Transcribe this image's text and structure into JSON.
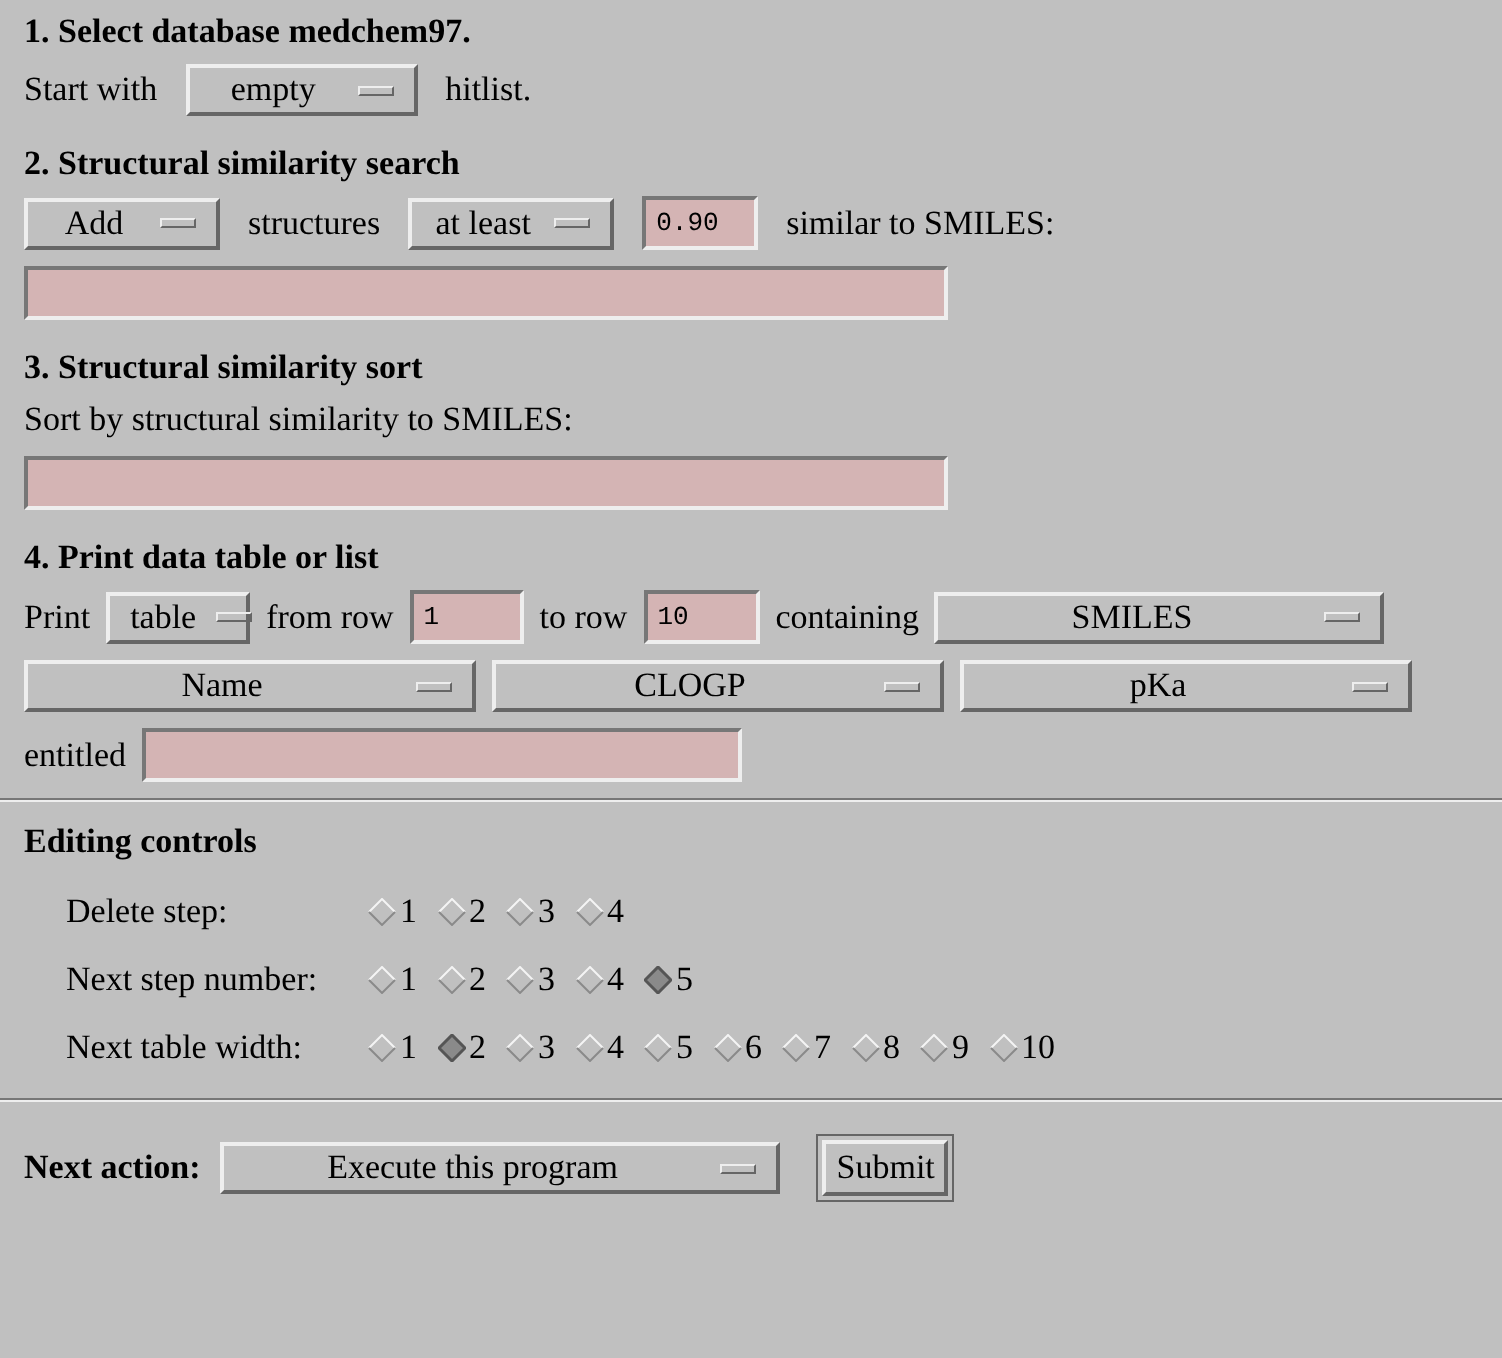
{
  "sections": [
    {
      "title": "1. Select database medchem97.",
      "rows": [
        {
          "items": [
            {
              "kind": "text",
              "text": "Start with"
            },
            {
              "kind": "menu",
              "value": "empty"
            },
            {
              "kind": "text",
              "text": "hitlist."
            }
          ]
        }
      ]
    },
    {
      "title": "2. Structural similarity search",
      "rows": [
        {
          "items": [
            {
              "kind": "menu",
              "value": "Add"
            },
            {
              "kind": "text",
              "text": "structures"
            },
            {
              "kind": "menu",
              "value": "at least"
            },
            {
              "kind": "input",
              "value": "0.90"
            },
            {
              "kind": "text",
              "text": "similar to SMILES:"
            }
          ]
        },
        {
          "items": [
            {
              "kind": "input"
            }
          ]
        }
      ]
    },
    {
      "title": "3. Structural similarity sort",
      "rows": [
        {
          "items": [
            {
              "kind": "text",
              "text": "Sort by structural similarity to SMILES:"
            }
          ]
        },
        {
          "items": [
            {
              "kind": "input"
            }
          ]
        }
      ]
    },
    {
      "title": "4. Print data table or list",
      "rows": [
        {
          "items": [
            {
              "kind": "text",
              "text": "Print"
            },
            {
              "kind": "menu",
              "value": "table"
            },
            {
              "kind": "text",
              "text": "from row"
            },
            {
              "kind": "input",
              "value": "1"
            },
            {
              "kind": "text",
              "text": "to row"
            },
            {
              "kind": "input",
              "value": "10"
            },
            {
              "kind": "text",
              "text": "containing"
            },
            {
              "kind": "menu",
              "value": "SMILES"
            }
          ]
        },
        {
          "items": [
            {
              "kind": "menu",
              "value": "Name"
            },
            {
              "kind": "menu",
              "value": "CLOGP"
            },
            {
              "kind": "menu",
              "value": "pKa"
            }
          ]
        },
        {
          "items": [
            {
              "kind": "text",
              "text": "entitled"
            },
            {
              "kind": "input"
            }
          ]
        }
      ]
    }
  ],
  "editing": {
    "title": "Editing controls",
    "groups": [
      {
        "label": "Delete step:",
        "options": [
          {
            "label": "1",
            "selected": false
          },
          {
            "label": "2",
            "selected": false
          },
          {
            "label": "3",
            "selected": false
          },
          {
            "label": "4",
            "selected": false
          }
        ]
      },
      {
        "label": "Next step number:",
        "options": [
          {
            "label": "1",
            "selected": false
          },
          {
            "label": "2",
            "selected": false
          },
          {
            "label": "3",
            "selected": false
          },
          {
            "label": "4",
            "selected": false
          },
          {
            "label": "5",
            "selected": true
          }
        ]
      },
      {
        "label": "Next table width:",
        "options": [
          {
            "label": "1",
            "selected": false
          },
          {
            "label": "2",
            "selected": true
          },
          {
            "label": "3",
            "selected": false
          },
          {
            "label": "4",
            "selected": false
          },
          {
            "label": "5",
            "selected": false
          },
          {
            "label": "6",
            "selected": false
          },
          {
            "label": "7",
            "selected": false
          },
          {
            "label": "8",
            "selected": false
          },
          {
            "label": "9",
            "selected": false
          },
          {
            "label": "10",
            "selected": false
          }
        ]
      }
    ]
  },
  "next_action": {
    "label": "Next action:",
    "menu": "Execute this program",
    "button": "Submit"
  }
}
